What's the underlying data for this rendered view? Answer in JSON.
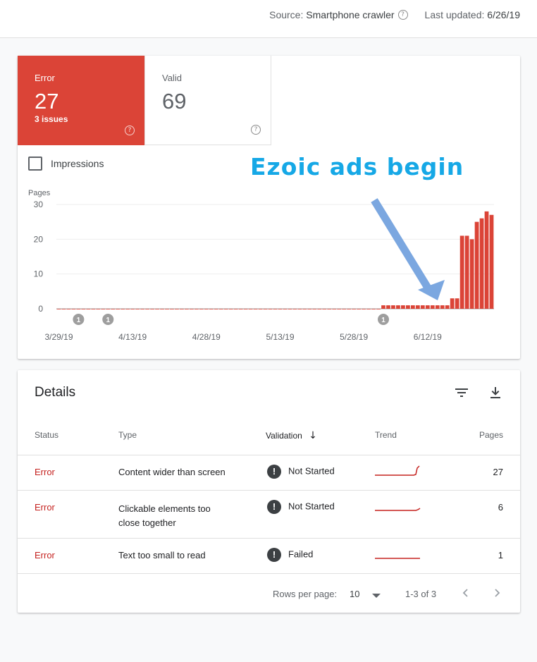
{
  "header": {
    "source_label": "Source:",
    "source_value": "Smartphone crawler",
    "updated_label": "Last updated:",
    "updated_value": "6/26/19"
  },
  "summary": {
    "error": {
      "label": "Error",
      "count": "27",
      "sub": "3 issues",
      "color": "#db4437"
    },
    "valid": {
      "label": "Valid",
      "count": "69"
    }
  },
  "impressions_label": "Impressions",
  "annotation_text": "Ezoic ads begin",
  "chart_data": {
    "type": "bar",
    "ylabel": "Pages",
    "ylim": [
      0,
      30
    ],
    "yticks": [
      "0",
      "10",
      "20",
      "30"
    ],
    "xticks": [
      "3/29/19",
      "4/13/19",
      "4/28/19",
      "5/13/19",
      "5/28/19",
      "6/12/19"
    ],
    "x_start": "3/29/19",
    "color": "#db4437",
    "annotation_marker_label": "1",
    "annotation_dates": [
      "4/2/19",
      "4/8/19",
      "6/3/19"
    ],
    "series": [
      {
        "values": [
          0,
          0,
          0,
          0,
          0,
          0,
          0,
          0,
          0,
          0,
          0,
          0,
          0,
          0,
          0,
          0,
          0,
          0,
          0,
          0,
          0,
          0,
          0,
          0,
          0,
          0,
          0,
          0,
          0,
          0,
          0,
          0,
          0,
          0,
          0,
          0,
          0,
          0,
          0,
          0,
          0,
          0,
          0,
          0,
          0,
          0,
          0,
          0,
          0,
          0,
          0,
          0,
          0,
          0,
          0,
          0,
          0,
          0,
          0,
          0,
          0,
          0,
          0,
          0,
          0,
          0,
          1,
          1,
          1,
          1,
          1,
          1,
          1,
          1,
          1,
          1,
          1,
          1,
          1,
          1,
          3,
          3,
          21,
          21,
          20,
          25,
          26,
          28,
          27
        ]
      }
    ]
  },
  "details": {
    "title": "Details",
    "columns": {
      "status": "Status",
      "type": "Type",
      "validation": "Validation",
      "trend": "Trend",
      "pages": "Pages"
    },
    "rows": [
      {
        "status": "Error",
        "type_line1": "Content wider than screen",
        "type_line2": "",
        "validation": "Not Started",
        "pages": "27"
      },
      {
        "status": "Error",
        "type_line1": "Clickable elements too",
        "type_line2": "close together",
        "validation": "Not Started",
        "pages": "6"
      },
      {
        "status": "Error",
        "type_line1": "Text too small to read",
        "type_line2": "",
        "validation": "Failed",
        "pages": "1"
      }
    ],
    "footer": {
      "rows_per_page_label": "Rows per page:",
      "rows_per_page_value": "10",
      "range": "1-3 of 3"
    }
  }
}
